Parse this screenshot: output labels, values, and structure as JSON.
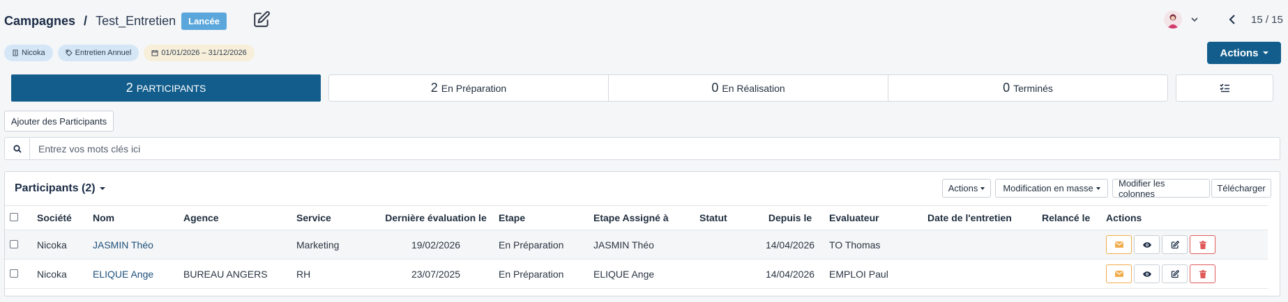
{
  "header": {
    "breadcrumb_root": "Campagnes",
    "breadcrumb_sep": "/",
    "campaign_name": "Test_Entretien",
    "status_badge": "Lancée",
    "pager": "15 / 15"
  },
  "tags": {
    "company": "Nicoka",
    "type": "Entretien Annuel",
    "period": "01/01/2026 – 31/12/2026"
  },
  "actions_label": "Actions",
  "stats": {
    "participants": {
      "count": "2",
      "label": "PARTICIPANTS"
    },
    "preparation": {
      "count": "2",
      "label": "En Préparation"
    },
    "realisation": {
      "count": "0",
      "label": "En Réalisation"
    },
    "termines": {
      "count": "0",
      "label": "Terminés"
    }
  },
  "add_participants_label": "Ajouter des Participants",
  "search": {
    "placeholder": "Entrez vos mots clés ici"
  },
  "panel": {
    "title": "Participants (2)",
    "toolbar": {
      "actions": "Actions",
      "bulk_edit": "Modification en masse",
      "edit_columns": "Modifier les colonnes",
      "download": "Télécharger"
    }
  },
  "table": {
    "columns": [
      "Société",
      "Nom",
      "Agence",
      "Service",
      "Dernière évaluation le",
      "Etape",
      "Etape Assigné à",
      "Statut",
      "Depuis le",
      "Evaluateur",
      "Date de l'entretien",
      "Relancé le",
      "Actions"
    ],
    "rows": [
      {
        "societe": "Nicoka",
        "nom": "JASMIN Théo",
        "agence": "",
        "service": "Marketing",
        "derniere_eval": "19/02/2026",
        "etape": "En Préparation",
        "assigne": "JASMIN Théo",
        "statut": "",
        "depuis": "14/04/2026",
        "evaluateur": "TO Thomas",
        "date_entretien": "",
        "relance": ""
      },
      {
        "societe": "Nicoka",
        "nom": "ELIQUE Ange",
        "agence": "BUREAU ANGERS",
        "service": "RH",
        "derniere_eval": "23/07/2025",
        "etape": "En Préparation",
        "assigne": "ELIQUE Ange",
        "statut": "",
        "depuis": "14/04/2026",
        "evaluateur": "EMPLOI Paul",
        "date_entretien": "",
        "relance": ""
      }
    ]
  },
  "colors": {
    "primary": "#125d8c",
    "badge": "#5ba7dc",
    "mail": "#f0ad4e",
    "delete": "#e05a5a"
  }
}
